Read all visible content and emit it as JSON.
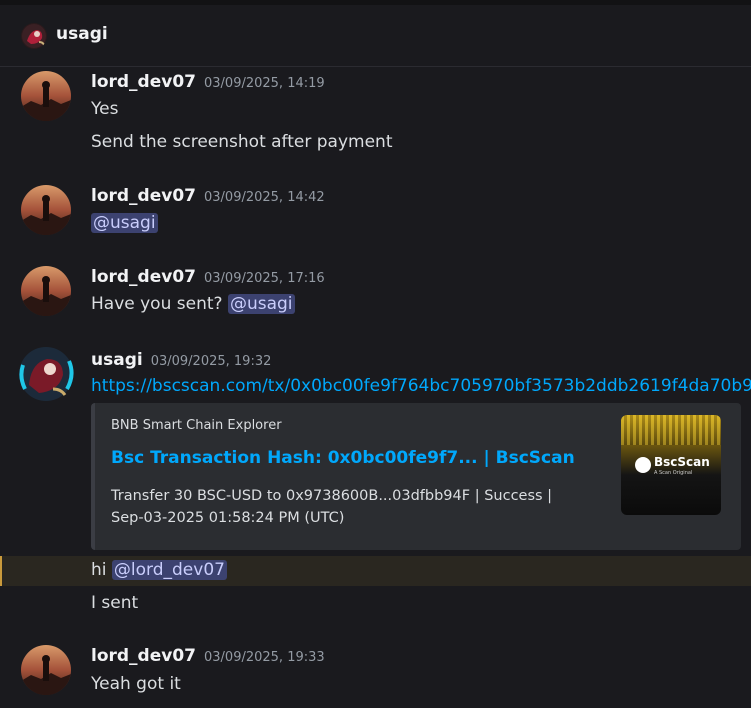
{
  "channel": {
    "title": "usagi",
    "avatar_icon": "usagi-avatar-icon"
  },
  "messages": [
    {
      "username": "lord_dev07",
      "timestamp": "03/09/2025, 14:19",
      "lines": [
        "Yes",
        "Send the screenshot after payment"
      ]
    },
    {
      "username": "lord_dev07",
      "timestamp": "03/09/2025, 14:42",
      "mention": "@usagi"
    },
    {
      "username": "lord_dev07",
      "timestamp": "03/09/2025, 17:16",
      "text": "Have you sent?",
      "mention": "@usagi"
    },
    {
      "username": "usagi",
      "timestamp": "03/09/2025, 19:32",
      "link": "https://bscscan.com/tx/0x0bc00fe9f764bc705970bf3573b2ddb2619f4da70b9",
      "embed": {
        "provider": "BNB Smart Chain Explorer",
        "title": "Bsc Transaction Hash: 0x0bc00fe9f7... | BscScan",
        "description_line1": "Transfer 30 BSC-USD to 0x9738600B...03dfbb94F | Success |",
        "description_line2": "Sep-03-2025 01:58:24 PM (UTC)",
        "thumb_brand": "BscScan",
        "thumb_sub": "A Scan Original"
      },
      "followups": [
        {
          "text": "hi",
          "mention": "@lord_dev07"
        },
        {
          "text": "I sent"
        }
      ]
    },
    {
      "username": "lord_dev07",
      "timestamp": "03/09/2025, 19:33",
      "lines": [
        "Yeah got it"
      ]
    }
  ],
  "colors": {
    "background": "#1a1a1e",
    "mention_bg": "#3c4270",
    "link": "#00a8fc",
    "highlight_border": "#c99a3c"
  }
}
